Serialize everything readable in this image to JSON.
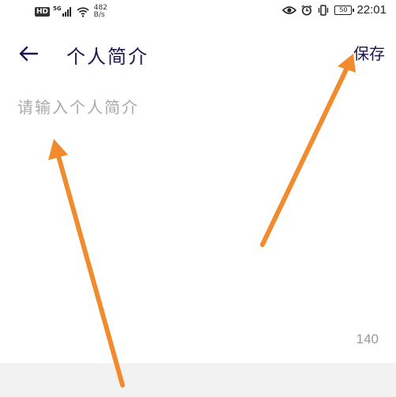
{
  "status_bar": {
    "network_badge": "HD",
    "network_type": "5G",
    "speed_value": "482",
    "speed_unit": "B/s",
    "battery_level": "50",
    "time": "22:01"
  },
  "toolbar": {
    "title": "个人简介",
    "save_label": "保存"
  },
  "bio": {
    "placeholder": "请输入个人简介",
    "value": ""
  },
  "counter": {
    "max_chars": "140"
  },
  "colors": {
    "title_color": "#1f1550",
    "arrow_color": "#f28a2e",
    "placeholder_color": "#a9a9a9"
  },
  "icons": [
    "back-arrow-icon",
    "eye-icon",
    "alarm-icon",
    "vibrate-icon",
    "battery-icon",
    "wifi-icon",
    "signal-icon"
  ]
}
